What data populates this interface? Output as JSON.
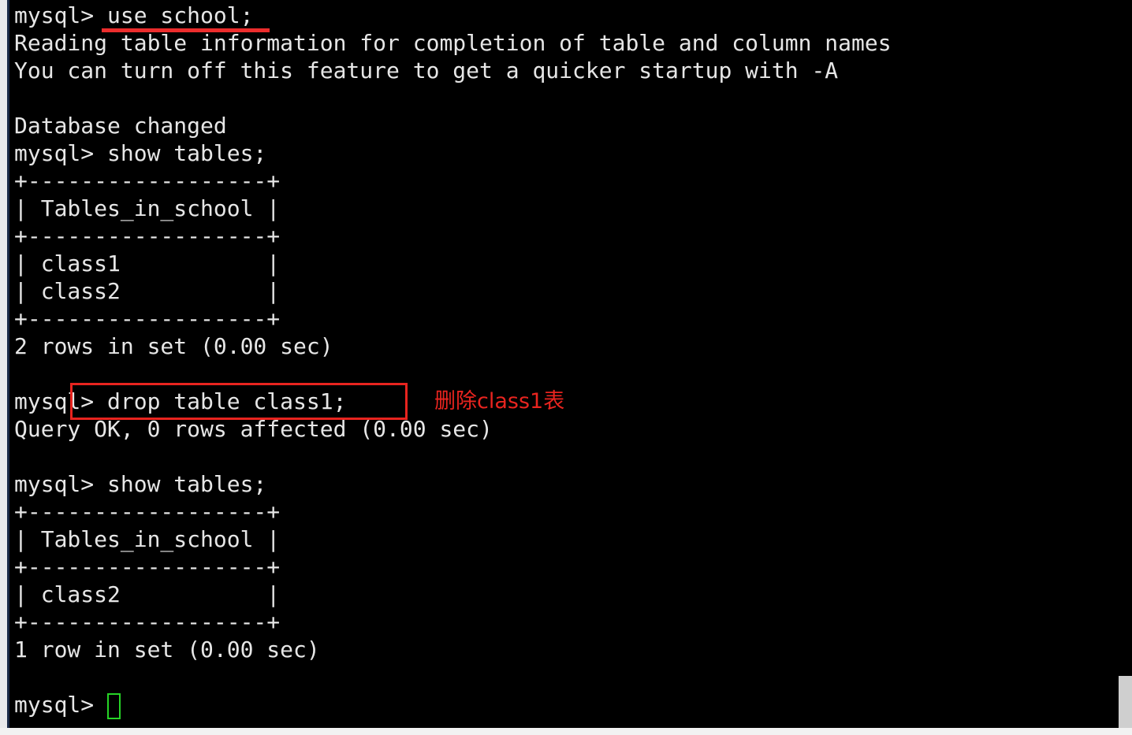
{
  "terminal": {
    "background_color": "#000000",
    "text_color": "#e6e6e6",
    "lines": [
      "mysql> use school;",
      "Reading table information for completion of table and column names",
      "You can turn off this feature to get a quicker startup with -A",
      "",
      "Database changed",
      "mysql> show tables;",
      "+------------------+",
      "| Tables_in_school |",
      "+------------------+",
      "| class1           |",
      "| class2           |",
      "+------------------+",
      "2 rows in set (0.00 sec)",
      "",
      "mysql> drop table class1;",
      "Query OK, 0 rows affected (0.00 sec)",
      "",
      "mysql> show tables;",
      "+------------------+",
      "| Tables_in_school |",
      "+------------------+",
      "| class2           |",
      "+------------------+",
      "1 row in set (0.00 sec)",
      "",
      "mysql> "
    ]
  },
  "annotations": {
    "underline": {
      "target_text": "use school;",
      "color": "#ec2d2d"
    },
    "highlight_box": {
      "target_text": "mysql> drop table class1;",
      "color": "#e8241f"
    },
    "note": {
      "text": "删除class1表",
      "color": "#e8241f"
    }
  },
  "cursor": {
    "style": "hollow-block",
    "color": "#26d426"
  },
  "scrollbar": {
    "orientation": "vertical",
    "thumb_color": "#cfcfcf",
    "track_color": "#000000"
  },
  "gutter": {
    "strip_color": "#e9e9eb",
    "rule_color": "#1b2a47"
  }
}
